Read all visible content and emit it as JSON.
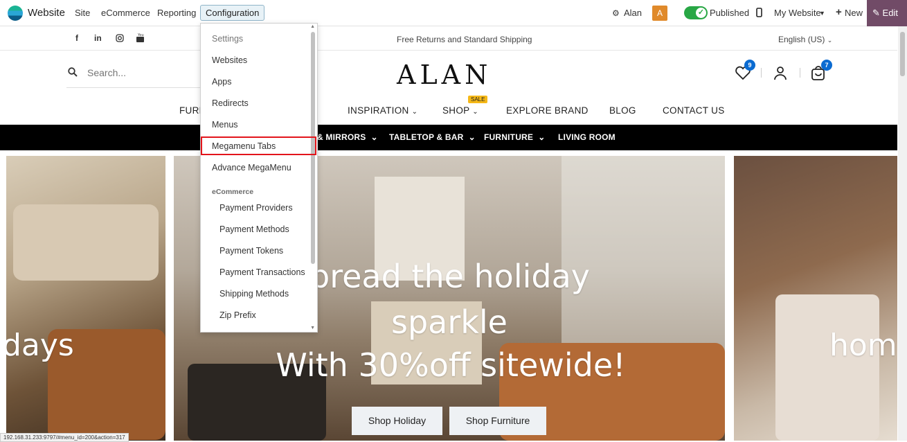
{
  "odoo_bar": {
    "brand": "Website",
    "menus": [
      "Site",
      "eCommerce",
      "Reporting"
    ],
    "active_menu": "Configuration",
    "user": "Alan",
    "avatar_letter": "A",
    "published_label": "Published",
    "website_selector": "My Website",
    "new_label": "New",
    "edit_label": "Edit",
    "accent_color": "#714b67"
  },
  "site_header": {
    "promo": "Free Returns and Standard Shipping",
    "language": "English (US)",
    "search_placeholder": "Search...",
    "logo": "ALAN",
    "wishlist_count": "9",
    "cart_count": "7"
  },
  "main_nav": {
    "items": [
      "FURN",
      "INSPIRATION",
      "SHOP",
      "EXPLORE BRAND",
      "BLOG",
      "CONTACT US"
    ],
    "sale_badge": "SALE"
  },
  "category_bar": {
    "items": [
      "& MIRRORS",
      "TABLETOP & BAR",
      "FURNITURE",
      "LIVING ROOM"
    ]
  },
  "hero": {
    "left_text": "days",
    "line1": "pread the holiday",
    "line2": "sparkle",
    "line3": "With 30%off sitewide!",
    "right_text": "hom",
    "buttons": [
      "Shop Holiday",
      "Shop Furniture"
    ]
  },
  "dropdown": {
    "items": [
      "Settings",
      "Websites",
      "Apps",
      "Redirects",
      "Menus",
      "Megamenu Tabs",
      "Advance MegaMenu"
    ],
    "section": "eCommerce",
    "sub_items": [
      "Payment Providers",
      "Payment Methods",
      "Payment Tokens",
      "Payment Transactions",
      "Shipping Methods",
      "Zip Prefix"
    ],
    "highlighted": "Megamenu Tabs"
  },
  "status_url": "192.168.31.233:9797/#menu_id=200&action=317"
}
